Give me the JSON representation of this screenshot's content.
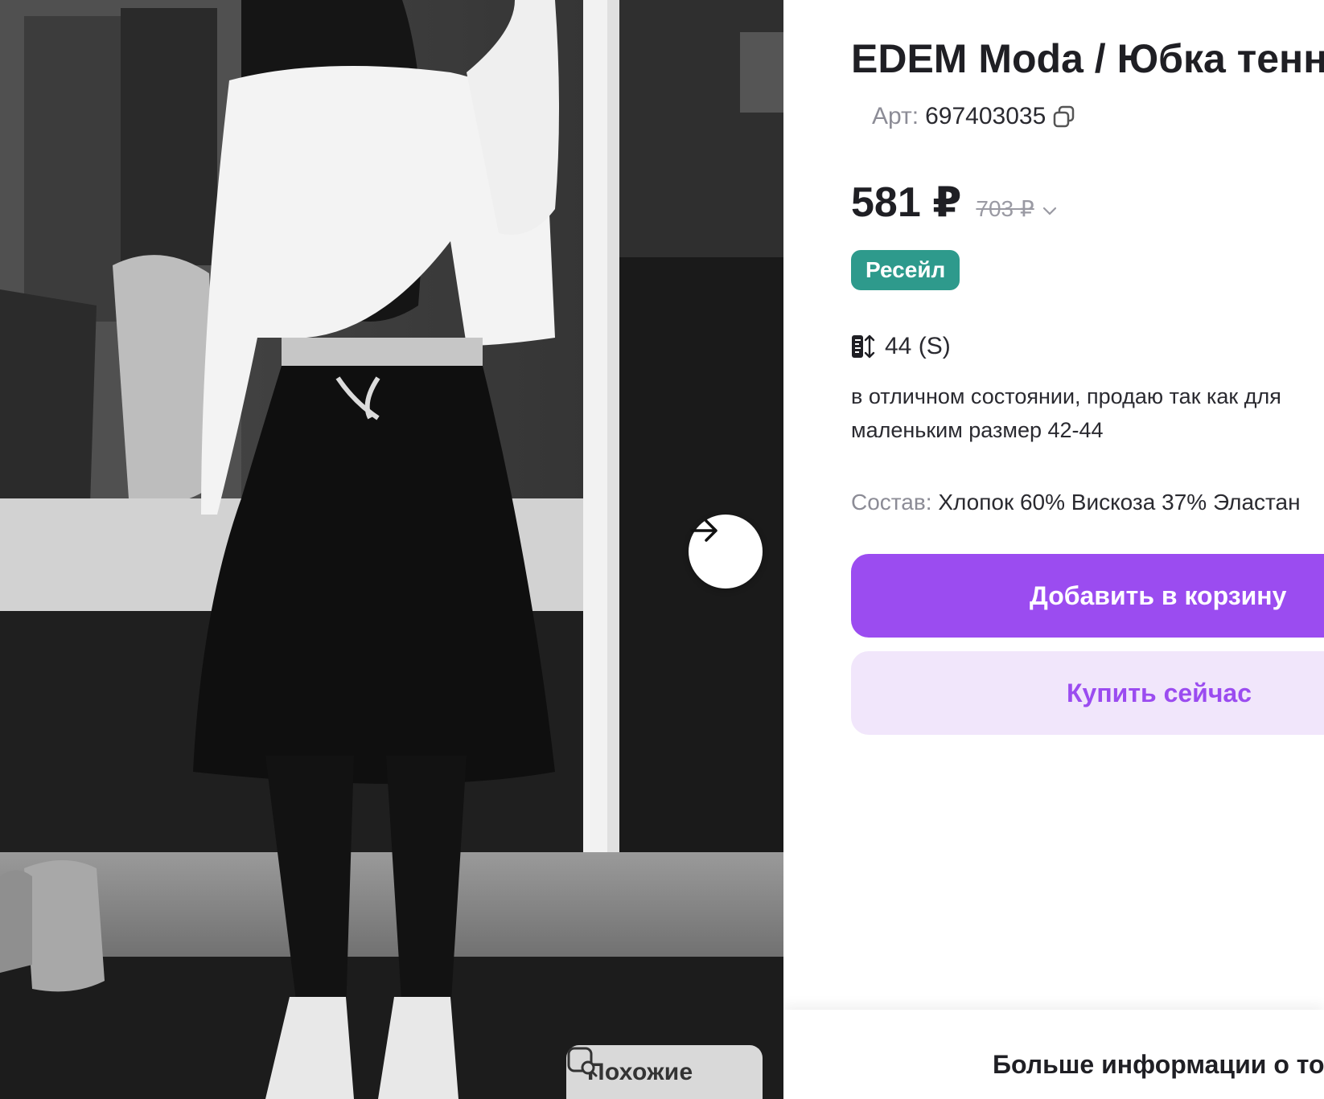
{
  "product": {
    "title": "EDEM Moda / Юбка тенн",
    "article_label": "Арт:",
    "article_value": "697403035",
    "price": "581 ₽",
    "old_price": "703 ₽",
    "badge": "Ресейл",
    "size": "44 (S)",
    "description_lines": [
      "в отличном состоянии, продаю так как для",
      "маленьким размер 42-44"
    ],
    "composition_label": "Состав:",
    "composition_value": "Хлопок 60% Вискоза 37% Эластан"
  },
  "actions": {
    "add_to_cart": "Добавить в корзину",
    "buy_now": "Купить сейчас",
    "similar": "Похожие",
    "more_info": "Больше информации о то"
  },
  "icons": {
    "next": "arrow-right-icon",
    "similar": "image-search-icon",
    "copy": "copy-icon",
    "size": "size-ruler-icon",
    "chevron": "chevron-down-icon"
  },
  "colors": {
    "accent": "#9b4cf0",
    "accent_light": "#f1e6fb",
    "badge": "#2e9a8c",
    "muted": "#8c8c96"
  }
}
